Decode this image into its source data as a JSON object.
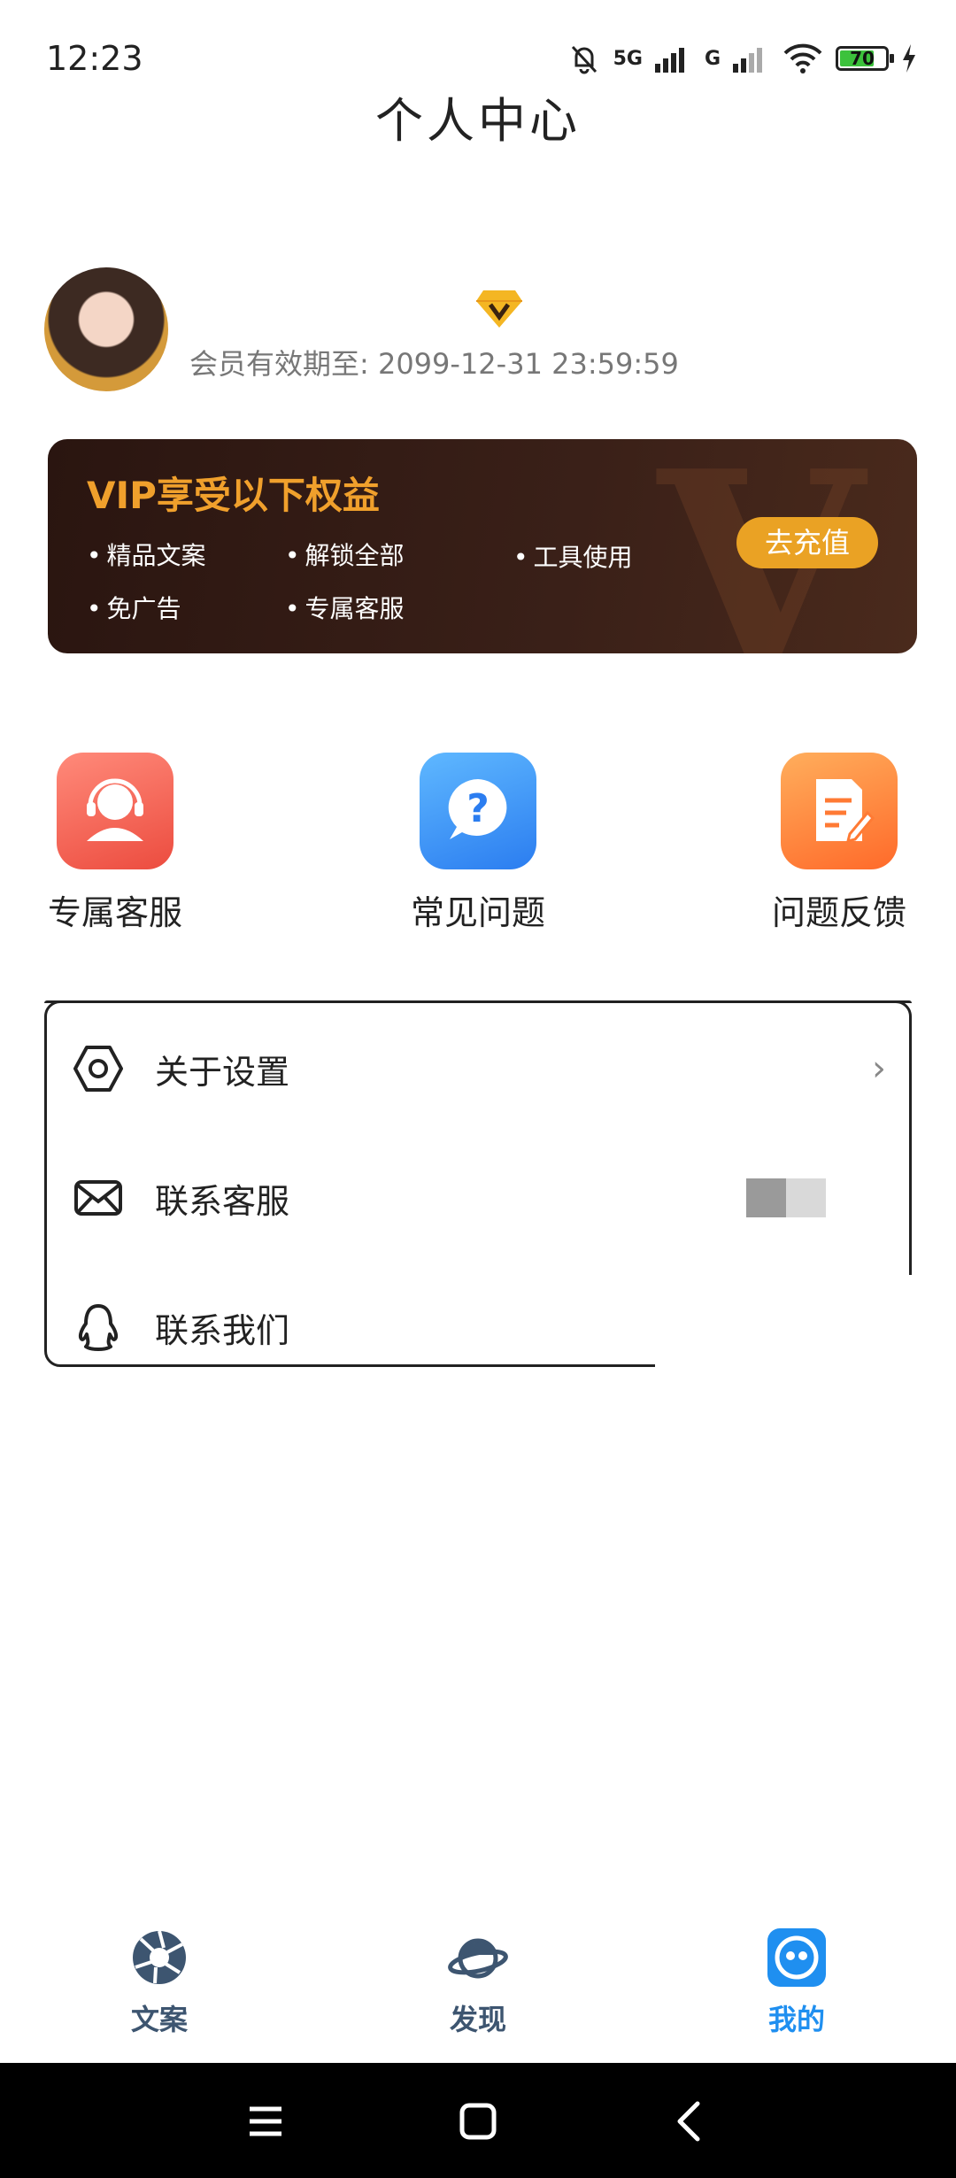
{
  "status_bar": {
    "time": "12:23",
    "network_1": "5G",
    "network_2": "G",
    "battery": "70"
  },
  "header": {
    "title": "个人中心"
  },
  "profile": {
    "expire_label": "会员有效期至: 2099-12-31 23:59:59"
  },
  "vip_banner": {
    "title": "VIP享受以下权益",
    "benefits": [
      "精品文案",
      "解锁全部",
      "工具使用",
      "免广告",
      "专属客服"
    ],
    "recharge_label": "去充值",
    "accent": "#f0a02c"
  },
  "quick_actions": [
    {
      "label": "专属客服",
      "icon": "headset-agent-icon"
    },
    {
      "label": "常见问题",
      "icon": "question-bubble-icon"
    },
    {
      "label": "问题反馈",
      "icon": "document-edit-icon"
    }
  ],
  "menu": {
    "items": [
      {
        "label": "关于设置",
        "icon": "hexagon-settings-icon"
      },
      {
        "label": "联系客服",
        "icon": "mail-icon"
      },
      {
        "label": "联系我们",
        "icon": "qq-penguin-icon"
      }
    ]
  },
  "bottom_nav": {
    "items": [
      {
        "label": "文案",
        "icon": "aperture-icon"
      },
      {
        "label": "发现",
        "icon": "planet-icon"
      },
      {
        "label": "我的",
        "icon": "smiley-face-icon"
      }
    ],
    "active_index": 2,
    "active_color": "#1f8ff0"
  }
}
